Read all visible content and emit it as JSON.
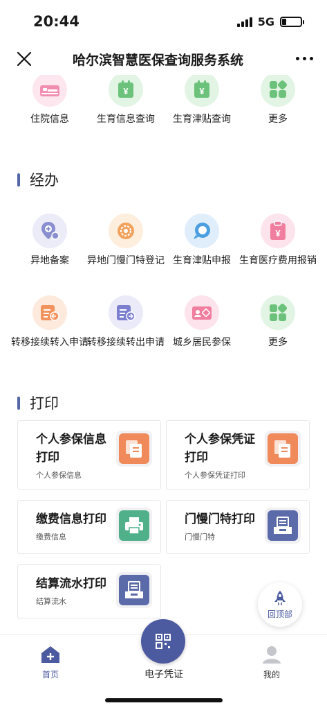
{
  "status": {
    "time": "20:44",
    "network": "5G"
  },
  "nav": {
    "title": "哈尔滨智慧医保查询服务系统"
  },
  "top_row": [
    {
      "label": "住院信息",
      "icon": "hospital-bed-icon",
      "color": "#f28fb0",
      "bg": "#fde6ee"
    },
    {
      "label": "生育信息查询",
      "icon": "yen-doc-icon",
      "color": "#6cc27a",
      "bg": "#e2f4e4"
    },
    {
      "label": "生育津贴查询",
      "icon": "yen-doc-icon",
      "color": "#6cc27a",
      "bg": "#e2f4e4"
    },
    {
      "label": "更多",
      "icon": "grid-more-icon",
      "color": "#6cc27a",
      "bg": "#e2f4e4"
    }
  ],
  "sections": {
    "handle": "经办",
    "print": "打印"
  },
  "handle_row1": [
    {
      "label": "异地备案",
      "icon": "location-plus-icon",
      "color": "#8a8fcf",
      "bg": "#ecebf8"
    },
    {
      "label": "异地门慢门特登记",
      "icon": "gear-badge-icon",
      "color": "#f2a25c",
      "bg": "#fdeedd"
    },
    {
      "label": "生育津贴申报",
      "icon": "chat-bubble-icon",
      "color": "#4b9ee0",
      "bg": "#e0eefb"
    },
    {
      "label": "生育医疗费用报销",
      "icon": "yen-clipboard-icon",
      "color": "#f07e9e",
      "bg": "#fde3eb"
    }
  ],
  "handle_row2": [
    {
      "label": "转移接续转入申请",
      "icon": "transfer-in-icon",
      "color": "#f2925c",
      "bg": "#fdeadd"
    },
    {
      "label": "转移接续转出申请",
      "icon": "transfer-out-icon",
      "color": "#7c7fd0",
      "bg": "#eaeaf8"
    },
    {
      "label": "城乡居民参保",
      "icon": "id-card-icon",
      "color": "#f07e9e",
      "bg": "#fde3eb"
    },
    {
      "label": "更多",
      "icon": "grid-more-icon",
      "color": "#6cc27a",
      "bg": "#e2f4e4"
    }
  ],
  "print_cards": [
    {
      "title": "个人参保信息打印",
      "sub": "个人参保信息",
      "icon": "document-copy-icon",
      "color": "#f08a5a"
    },
    {
      "title": "个人参保凭证打印",
      "sub": "个人参保凭证打印",
      "icon": "document-copy-icon",
      "color": "#f08a5a"
    },
    {
      "title": "缴费信息打印",
      "sub": "缴费信息",
      "icon": "printer-icon",
      "color": "#4fb08a"
    },
    {
      "title": "门慢门特打印",
      "sub": "门慢门特",
      "icon": "tray-icon",
      "color": "#5b6aa8"
    },
    {
      "title": "结算流水打印",
      "sub": "结算流水",
      "icon": "tray-icon",
      "color": "#5b6aa8"
    }
  ],
  "back_top": "回顶部",
  "tabs": {
    "home": "首页",
    "center": "电子凭证",
    "mine": "我的"
  }
}
